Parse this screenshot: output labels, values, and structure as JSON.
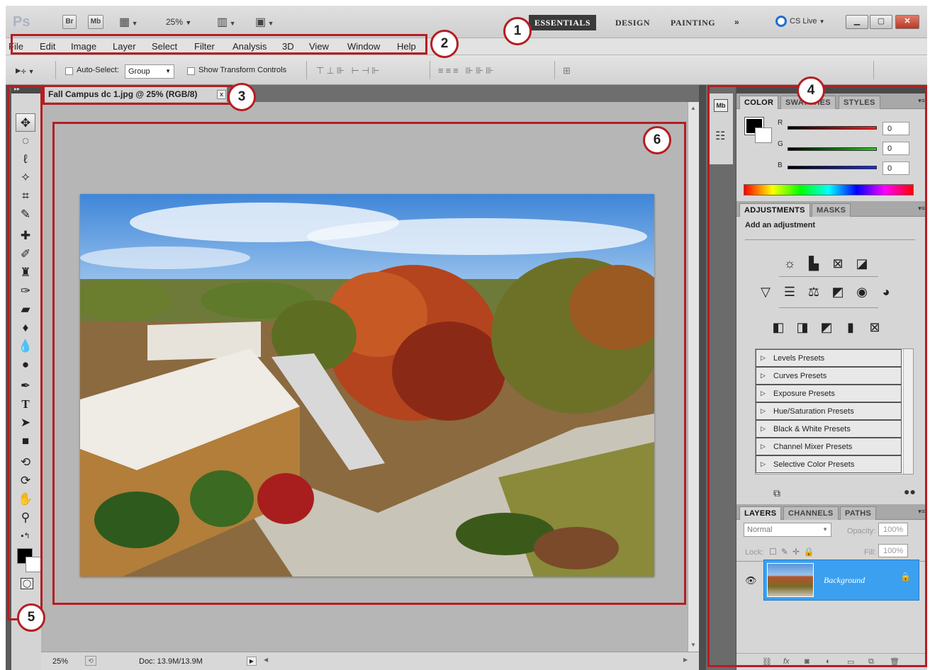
{
  "appbar": {
    "logo": "Ps",
    "br_label": "Br",
    "mb_label": "Mb",
    "zoom": "25%",
    "workspaces": [
      "ESSENTIALS",
      "DESIGN",
      "PAINTING"
    ],
    "more": "»",
    "cslive": "CS Live"
  },
  "menu": [
    "File",
    "Edit",
    "Image",
    "Layer",
    "Select",
    "Filter",
    "Analysis",
    "3D",
    "View",
    "Window",
    "Help"
  ],
  "options": {
    "auto_select_label": "Auto-Select:",
    "auto_select_value": "Group",
    "show_transform_label": "Show Transform Controls"
  },
  "document": {
    "tab_title": "Fall Campus dc 1.jpg @ 25% (RGB/8)",
    "close": "x"
  },
  "status": {
    "zoom": "25%",
    "doc_size": "Doc: 13.9M/13.9M"
  },
  "color_panel": {
    "tabs": [
      "COLOR",
      "SWATCHES",
      "STYLES"
    ],
    "channels": [
      {
        "label": "R",
        "value": "0",
        "color": "#d01c1c"
      },
      {
        "label": "G",
        "value": "0",
        "color": "#1ca21c"
      },
      {
        "label": "B",
        "value": "0",
        "color": "#1c2cd0"
      }
    ]
  },
  "adjustments_panel": {
    "tabs": [
      "ADJUSTMENTS",
      "MASKS"
    ],
    "heading": "Add an adjustment",
    "presets": [
      "Levels Presets",
      "Curves Presets",
      "Exposure Presets",
      "Hue/Saturation Presets",
      "Black & White Presets",
      "Channel Mixer Presets",
      "Selective Color Presets"
    ]
  },
  "layers_panel": {
    "tabs": [
      "LAYERS",
      "CHANNELS",
      "PATHS"
    ],
    "blend_mode": "Normal",
    "opacity_label": "Opacity:",
    "opacity_value": "100%",
    "lock_label": "Lock:",
    "fill_label": "Fill:",
    "fill_value": "100%",
    "layer_name": "Background"
  },
  "annotations": [
    "1",
    "2",
    "3",
    "4",
    "5",
    "6"
  ],
  "colors": {
    "annotation": "#b41e22",
    "layer_selected": "#3ba0f0",
    "workspace_active": "#3a3a3a"
  }
}
